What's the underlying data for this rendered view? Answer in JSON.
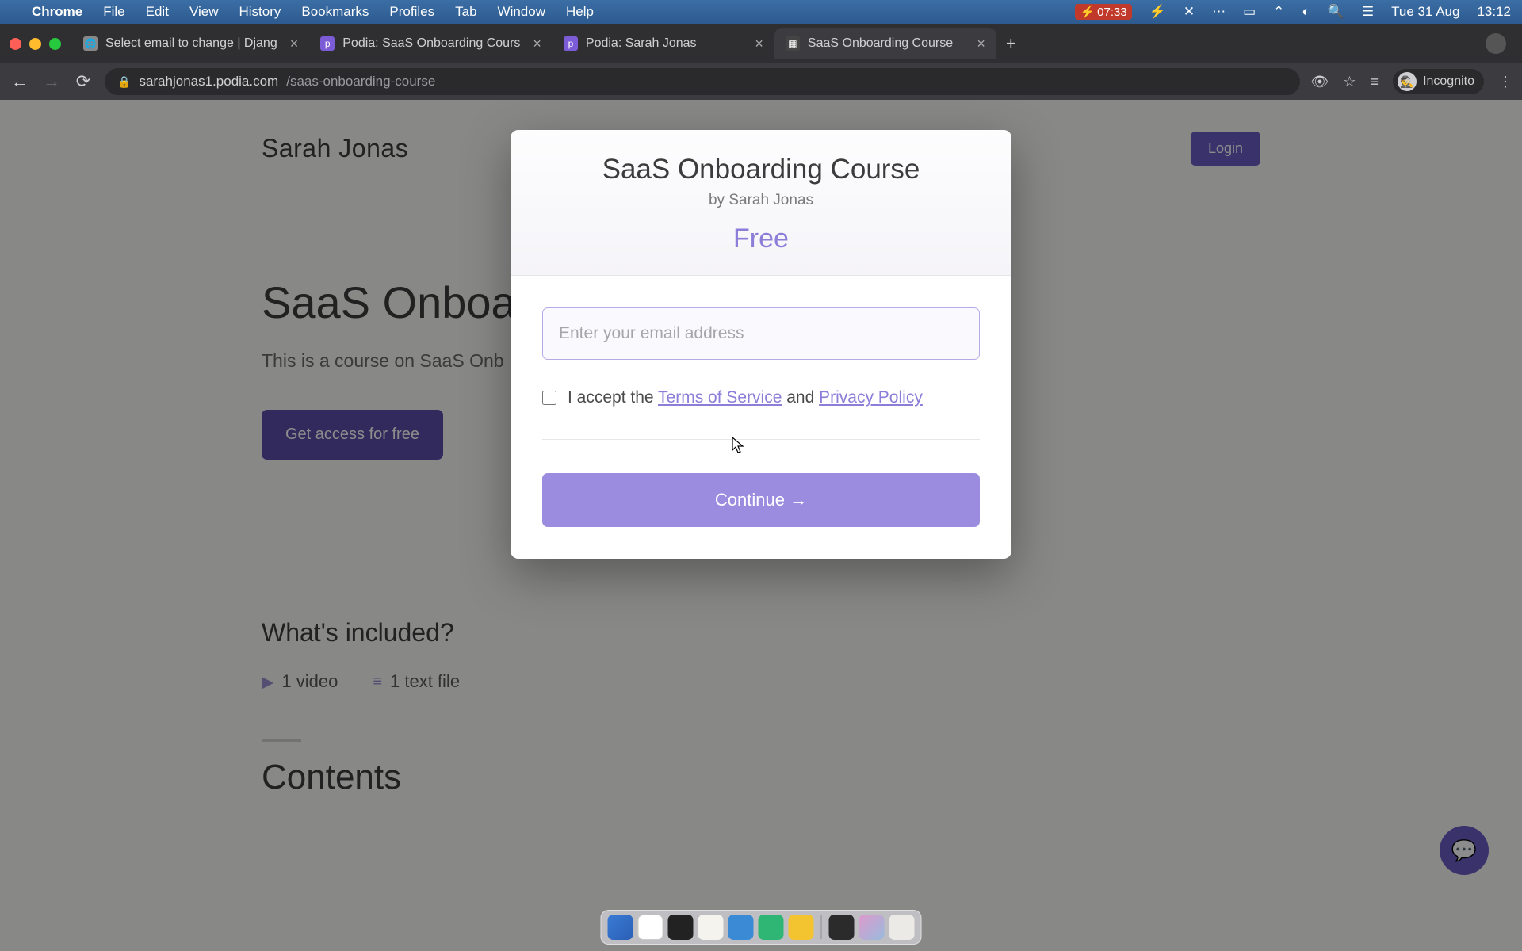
{
  "menubar": {
    "app": "Chrome",
    "items": [
      "File",
      "Edit",
      "View",
      "History",
      "Bookmarks",
      "Profiles",
      "Tab",
      "Window",
      "Help"
    ],
    "battery_time": "07:33",
    "date": "Tue 31 Aug",
    "clock": "13:12"
  },
  "tabs": [
    {
      "label": "Select email to change | Djang"
    },
    {
      "label": "Podia: SaaS Onboarding Cours"
    },
    {
      "label": "Podia: Sarah Jonas"
    },
    {
      "label": "SaaS Onboarding Course"
    }
  ],
  "url": {
    "host": "sarahjonas1.podia.com",
    "path": "/saas-onboarding-course"
  },
  "incognito_label": "Incognito",
  "page": {
    "site_title": "Sarah Jonas",
    "login": "Login",
    "hero_title": "SaaS Onboard",
    "hero_sub": "This is a course on SaaS Onb",
    "cta": "Get access for free",
    "included_title": "What's included?",
    "video_count": "1 video",
    "text_count": "1 text file",
    "contents_title": "Contents"
  },
  "modal": {
    "title": "SaaS Onboarding Course",
    "byline": "by Sarah Jonas",
    "price": "Free",
    "email_placeholder": "Enter your email address",
    "accept_prefix": "I accept the ",
    "tos": "Terms of Service",
    "and": " and ",
    "privacy": "Privacy Policy",
    "continue": "Continue →"
  }
}
